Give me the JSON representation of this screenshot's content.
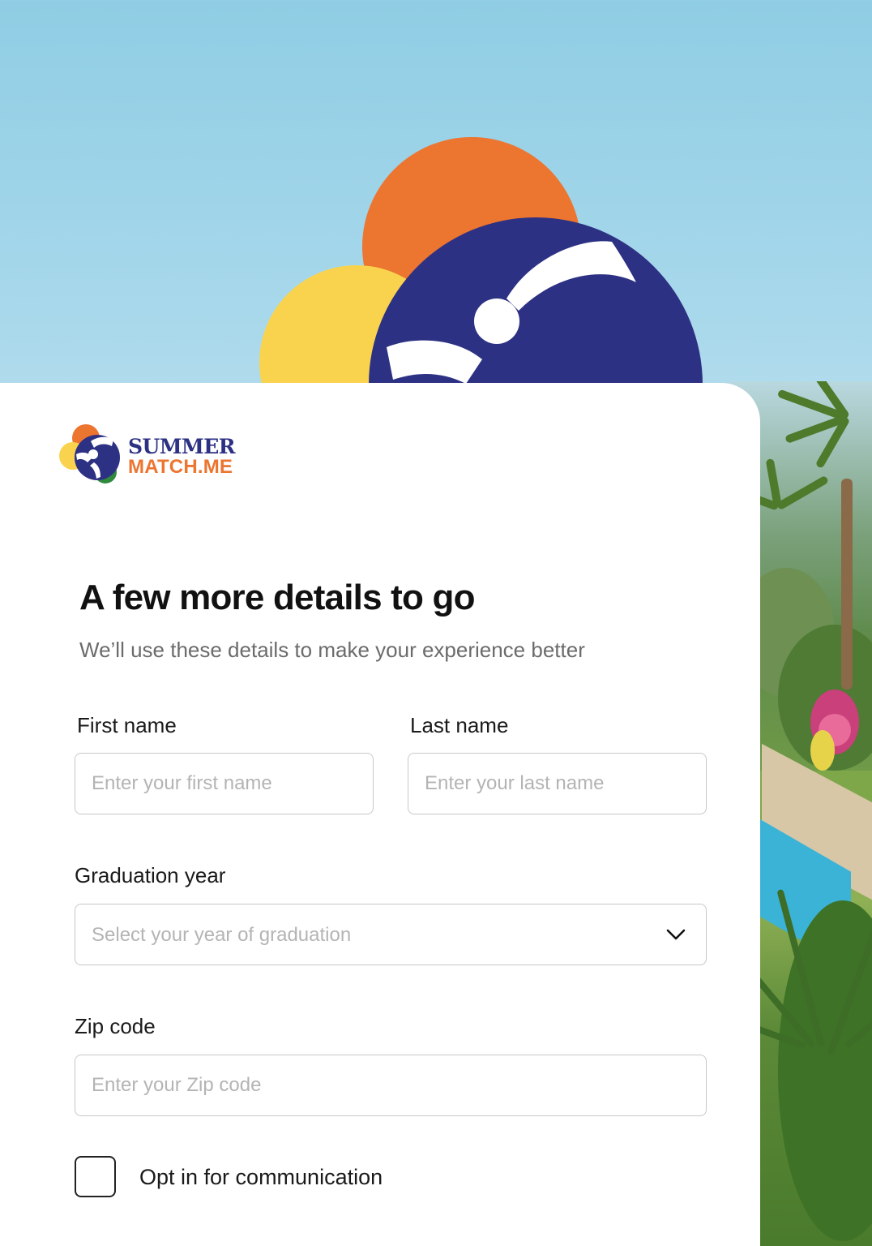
{
  "brand": {
    "line1": "SUMMER",
    "line2": "MATCH.ME",
    "colors": {
      "navy": "#2d3184",
      "orange": "#ec7530",
      "yellow": "#fad34e",
      "green": "#2f8a3c"
    }
  },
  "form": {
    "title": "A few more details to go",
    "subtitle": "We’ll use these details to make your experience better",
    "first_name": {
      "label": "First name",
      "placeholder": "Enter your first name",
      "value": ""
    },
    "last_name": {
      "label": "Last name",
      "placeholder": "Enter your last name",
      "value": ""
    },
    "graduation_year": {
      "label": "Graduation year",
      "placeholder": "Select your year of graduation",
      "icon": "chevron-down-icon"
    },
    "zip_code": {
      "label": "Zip code",
      "placeholder": "Enter your Zip code",
      "value": ""
    },
    "opt_in": {
      "label": "Opt in for communication",
      "checked": false
    }
  }
}
